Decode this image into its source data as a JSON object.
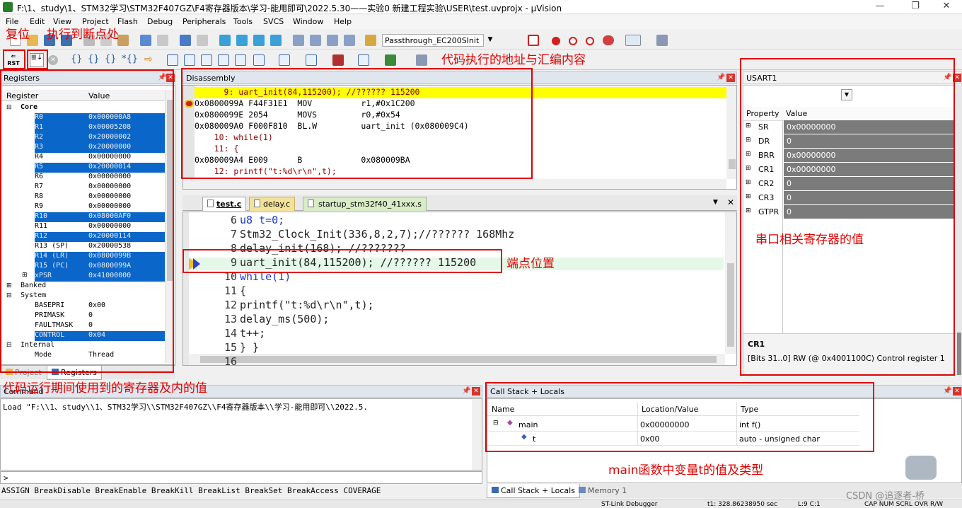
{
  "window": {
    "title": "F:\\1、study\\1、STM32学习\\STM32F407GZ\\F4寄存器版本\\学习-能用即可\\2022.5.30——实验0 新建工程实验\\USER\\test.uvprojx - µVision"
  },
  "menu": [
    "File",
    "Edit",
    "View",
    "Project",
    "Flash",
    "Debug",
    "Peripherals",
    "Tools",
    "SVCS",
    "Window",
    "Help"
  ],
  "toolbar": {
    "target": "Passthrough_EC200SInit"
  },
  "registers": {
    "title": "Registers",
    "col_register": "Register",
    "col_value": "Value",
    "core": "Core",
    "rows": [
      {
        "n": "R0",
        "v": "0x000000A8",
        "sel": true
      },
      {
        "n": "R1",
        "v": "0x00005208",
        "sel": true
      },
      {
        "n": "R2",
        "v": "0x20000002",
        "sel": true
      },
      {
        "n": "R3",
        "v": "0x20000000",
        "sel": true
      },
      {
        "n": "R4",
        "v": "0x00000000",
        "sel": false
      },
      {
        "n": "R5",
        "v": "0x20000014",
        "sel": true
      },
      {
        "n": "R6",
        "v": "0x00000000",
        "sel": false
      },
      {
        "n": "R7",
        "v": "0x00000000",
        "sel": false
      },
      {
        "n": "R8",
        "v": "0x00000000",
        "sel": false
      },
      {
        "n": "R9",
        "v": "0x00000000",
        "sel": false
      },
      {
        "n": "R10",
        "v": "0x08000AF0",
        "sel": true
      },
      {
        "n": "R11",
        "v": "0x00000000",
        "sel": false
      },
      {
        "n": "R12",
        "v": "0x20000114",
        "sel": true
      },
      {
        "n": "R13 (SP)",
        "v": "0x20000538",
        "sel": false
      },
      {
        "n": "R14 (LR)",
        "v": "0x0800099B",
        "sel": true
      },
      {
        "n": "R15 (PC)",
        "v": "0x0800099A",
        "sel": true
      },
      {
        "n": "xPSR",
        "v": "0x41000000",
        "sel": true
      }
    ],
    "banked": "Banked",
    "system": "System",
    "sysrows": [
      {
        "n": "BASEPRI",
        "v": "0x00",
        "sel": false
      },
      {
        "n": "PRIMASK",
        "v": "0",
        "sel": false
      },
      {
        "n": "FAULTMASK",
        "v": "0",
        "sel": false
      },
      {
        "n": "CONTROL",
        "v": "0x04",
        "sel": true
      }
    ],
    "internal": "Internal",
    "mode_n": "Mode",
    "mode_v": "Thread",
    "tab_project": "Project",
    "tab_registers": "Registers"
  },
  "disassembly": {
    "title": "Disassembly",
    "lines": [
      {
        "t": "      9: uart_init(84,115200); //?????? 115200",
        "k": "hl"
      },
      {
        "t": "0x0800099A F44F31E1  MOV          r1,#0x1C200",
        "k": "cur"
      },
      {
        "t": "0x0800099E 2054      MOVS         r0,#0x54",
        "k": "asm"
      },
      {
        "t": "0x080009A0 F000F810  BL.W         uart_init (0x080009C4)",
        "k": "asm"
      },
      {
        "t": "    10: while(1)",
        "k": "src"
      },
      {
        "t": "    11: {",
        "k": "src"
      },
      {
        "t": "0x080009A4 E009      B            0x080009BA",
        "k": "asm"
      },
      {
        "t": "    12: printf(\"t:%d\\r\\n\",t);",
        "k": "src"
      }
    ]
  },
  "editor": {
    "tabs": [
      "test.c",
      "delay.c",
      "startup_stm32f40_41xxx.s"
    ],
    "lines": [
      {
        "n": "6",
        "t": "u8 t=0;"
      },
      {
        "n": "7",
        "t": "Stm32_Clock_Init(336,8,2,7);//?????? 168Mhz"
      },
      {
        "n": "8",
        "t": "delay_init(168); //???????"
      },
      {
        "n": "9",
        "t": "uart_init(84,115200); //?????? 115200"
      },
      {
        "n": "10",
        "t": "while(1)"
      },
      {
        "n": "11",
        "t": "{"
      },
      {
        "n": "12",
        "t": "printf(\"t:%d\\r\\n\",t);"
      },
      {
        "n": "13",
        "t": "delay_ms(500);"
      },
      {
        "n": "14",
        "t": "t++;"
      },
      {
        "n": "15",
        "t": "} }"
      },
      {
        "n": "16",
        "t": ""
      }
    ]
  },
  "usart": {
    "title": "USART1",
    "col_property": "Property",
    "col_value": "Value",
    "rows": [
      {
        "n": "SR",
        "v": "0x00000000"
      },
      {
        "n": "DR",
        "v": "0"
      },
      {
        "n": "BRR",
        "v": "0x00000000"
      },
      {
        "n": "CR1",
        "v": "0x00000000"
      },
      {
        "n": "CR2",
        "v": "0"
      },
      {
        "n": "CR3",
        "v": "0"
      },
      {
        "n": "GTPR",
        "v": "0"
      }
    ],
    "desc_title": "CR1",
    "desc_text": "[Bits 31..0] RW (@ 0x4001100C) Control register 1"
  },
  "command": {
    "title": "Command",
    "text": "Load \"F:\\\\1、study\\\\1、STM32学习\\\\STM32F407GZ\\\\F4寄存器版本\\\\学习-能用即可\\\\2022.5.",
    "prompt": ">",
    "hints": "ASSIGN BreakDisable BreakEnable BreakKill BreakList BreakSet BreakAccess COVERAGE"
  },
  "callstack": {
    "title": "Call Stack + Locals",
    "cols": [
      "Name",
      "Location/Value",
      "Type"
    ],
    "rows": [
      {
        "n": "main",
        "l": "0x00000000",
        "t": "int f()"
      },
      {
        "n": "t",
        "l": "0x00",
        "t": "auto - unsigned char"
      }
    ],
    "tab1": "Call Stack + Locals",
    "tab2": "Memory 1"
  },
  "status": {
    "left": "ST-Link Debugger",
    "time": "t1: 328.86238950 sec",
    "pos": "L:9 C:1",
    "caps": "CAP NUM SCRL OVR R/W"
  },
  "annotations": {
    "reset": "复位",
    "run_to_bp": "执行到断点处",
    "disasm": "代码执行的地址与汇编内容",
    "usart": "串口相关寄存器的值",
    "bp": "端点位置",
    "regs": "代码运行期间使用到的寄存器及内的值",
    "locals": "main函数中变量t的值及类型"
  },
  "watermark": "CSDN @追逐者-桥"
}
